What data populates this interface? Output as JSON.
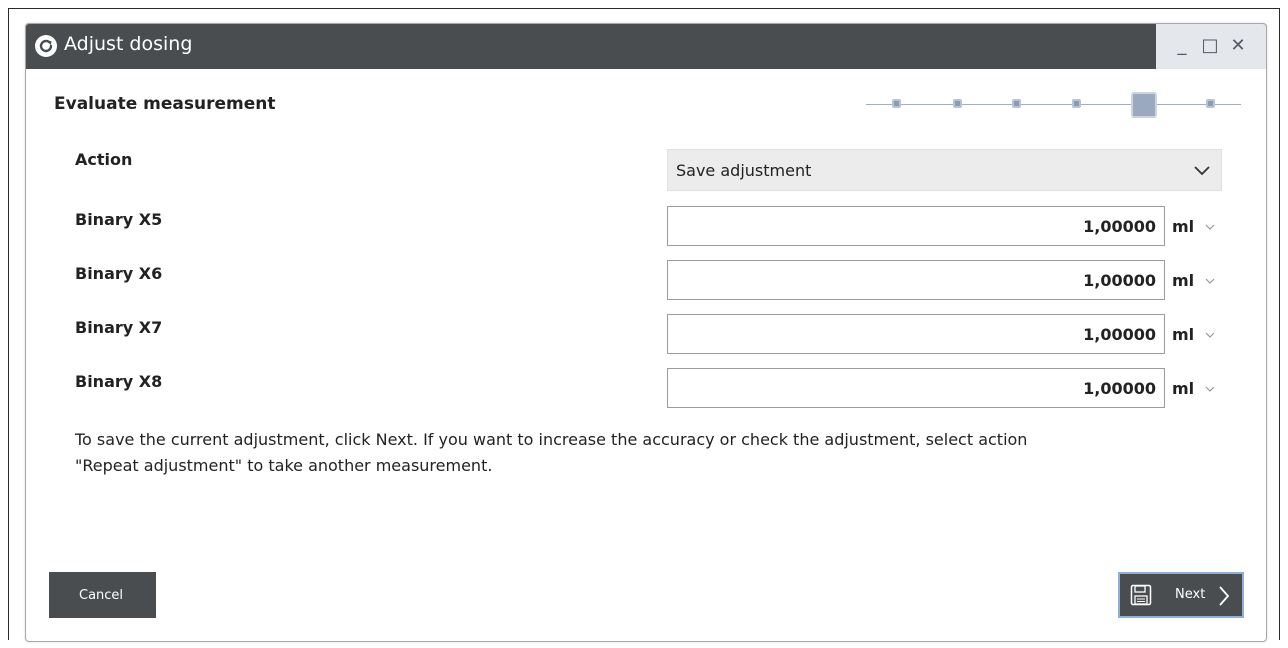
{
  "window": {
    "title": "Adjust dosing",
    "controls": {
      "minimize": "_",
      "maximize": "□",
      "close": "✕"
    }
  },
  "step": {
    "title": "Evaluate measurement",
    "total_steps": 6,
    "current_step": 5
  },
  "form": {
    "action": {
      "label": "Action",
      "value": "Save adjustment"
    },
    "rows": [
      {
        "label": "Binary X5",
        "value": "1,00000",
        "unit": "ml"
      },
      {
        "label": "Binary X6",
        "value": "1,00000",
        "unit": "ml"
      },
      {
        "label": "Binary X7",
        "value": "1,00000",
        "unit": "ml"
      },
      {
        "label": "Binary X8",
        "value": "1,00000",
        "unit": "ml"
      }
    ]
  },
  "info": {
    "line1": "To save the current adjustment, click Next. If you want to increase the accuracy or check the adjustment, select action",
    "line2": "\"Repeat adjustment\" to take another measurement."
  },
  "buttons": {
    "cancel": "Cancel",
    "next": "Next"
  },
  "colors": {
    "titlebar": "#4a4d50",
    "window_controls_bg": "#e4e8ed",
    "button_bg": "#4a4d50",
    "next_border": "#8fb1d9",
    "step_active": "#9aa9bd"
  },
  "icons": {
    "app": "refresh-circle-icon",
    "save": "floppy-disk-icon",
    "next": "chevron-right-icon",
    "dropdown": "chevron-down-icon"
  }
}
